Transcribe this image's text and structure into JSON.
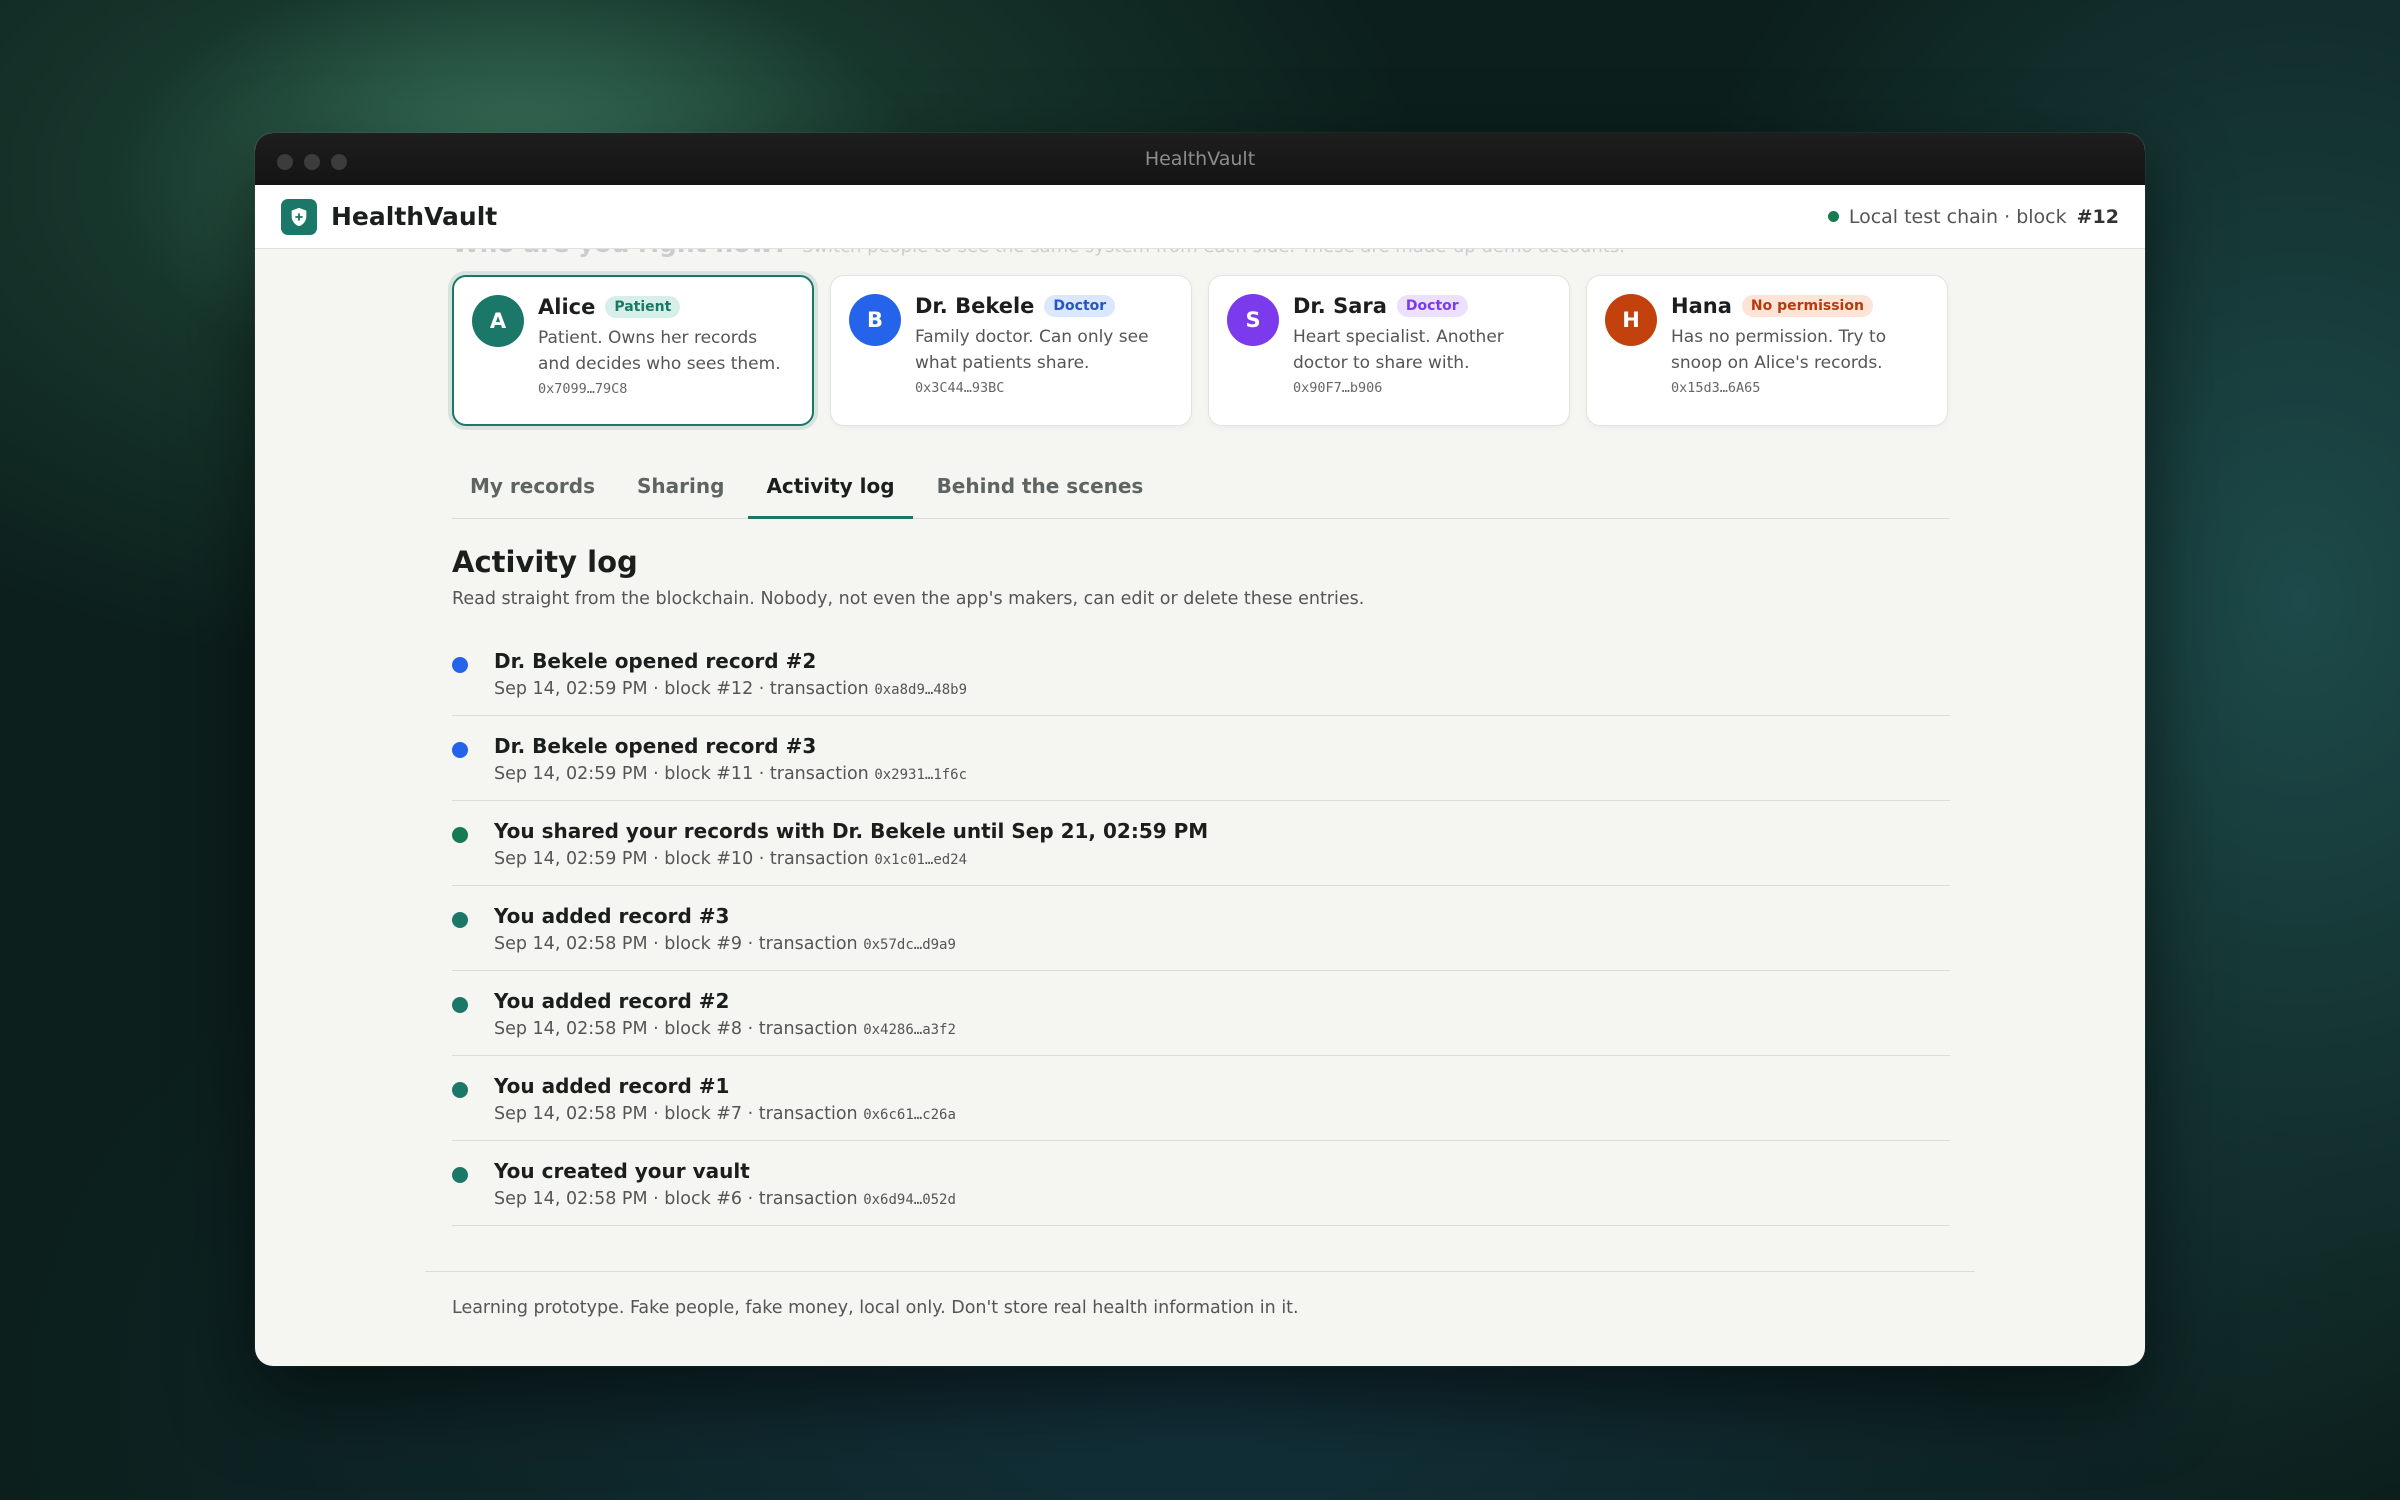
{
  "window": {
    "title": "HealthVault"
  },
  "app": {
    "brand": "HealthVault",
    "chain_status": "Local test chain · block",
    "block": "#12"
  },
  "heading": {
    "title": "Who are you right now?",
    "subtitle": "Switch people to see the same system from each side. These are made-up demo accounts."
  },
  "personas": [
    {
      "initial": "A",
      "name": "Alice",
      "role": "Patient",
      "desc": "Patient. Owns her records and decides who sees them.",
      "address": "0x7099…79C8",
      "avatar_color": "#1b7868",
      "badge_bg": "#d7efe8",
      "badge_fg": "#1b7868"
    },
    {
      "initial": "B",
      "name": "Dr. Bekele",
      "role": "Doctor",
      "desc": "Family doctor. Can only see what patients share.",
      "address": "0x3C44…93BC",
      "avatar_color": "#2563eb",
      "badge_bg": "#dbe7fd",
      "badge_fg": "#2456c8"
    },
    {
      "initial": "S",
      "name": "Dr. Sara",
      "role": "Doctor",
      "desc": "Heart specialist. Another doctor to share with.",
      "address": "0x90F7…b906",
      "avatar_color": "#7c3aed",
      "badge_bg": "#ece1fd",
      "badge_fg": "#7c3aed"
    },
    {
      "initial": "H",
      "name": "Hana",
      "role": "No permission",
      "desc": "Has no permission. Try to snoop on Alice's records.",
      "address": "0x15d3…6A65",
      "avatar_color": "#c2410c",
      "badge_bg": "#fde4d6",
      "badge_fg": "#b83a0c"
    }
  ],
  "tabs": [
    "My records",
    "Sharing",
    "Activity log",
    "Behind the scenes"
  ],
  "active_tab": "Activity log",
  "section": {
    "title": "Activity log",
    "subtitle": "Read straight from the blockchain. Nobody, not even the app's makers, can edit or delete these entries."
  },
  "log": [
    {
      "title": "Dr. Bekele opened record #2",
      "meta": "Sep 14, 02:59 PM · block #12 · transaction",
      "tx": "0xa8d9…48b9",
      "color": "#2563eb"
    },
    {
      "title": "Dr. Bekele opened record #3",
      "meta": "Sep 14, 02:59 PM · block #11 · transaction",
      "tx": "0x2931…1f6c",
      "color": "#2563eb"
    },
    {
      "title": "You shared your records with Dr. Bekele until Sep 21, 02:59 PM",
      "meta": "Sep 14, 02:59 PM · block #10 · transaction",
      "tx": "0x1c01…ed24",
      "color": "#167a52"
    },
    {
      "title": "You added record #3",
      "meta": "Sep 14, 02:58 PM · block #9 · transaction",
      "tx": "0x57dc…d9a9",
      "color": "#1b7868"
    },
    {
      "title": "You added record #2",
      "meta": "Sep 14, 02:58 PM · block #8 · transaction",
      "tx": "0x4286…a3f2",
      "color": "#1b7868"
    },
    {
      "title": "You added record #1",
      "meta": "Sep 14, 02:58 PM · block #7 · transaction",
      "tx": "0x6c61…c26a",
      "color": "#1b7868"
    },
    {
      "title": "You created your vault",
      "meta": "Sep 14, 02:58 PM · block #6 · transaction",
      "tx": "0x6d94…052d",
      "color": "#1b7868"
    }
  ],
  "footer": "Learning prototype. Fake people, fake money, local only. Don't store real health information in it."
}
